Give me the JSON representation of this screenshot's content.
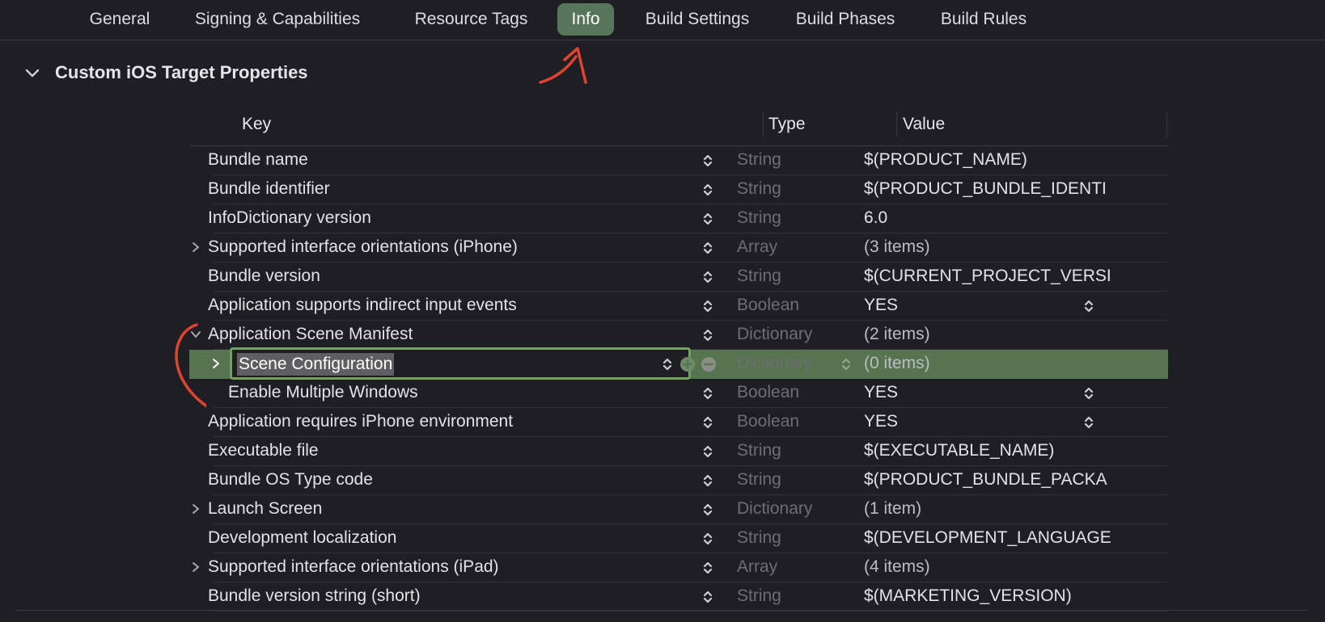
{
  "tabs": [
    {
      "label": "General"
    },
    {
      "label": "Signing & Capabilities"
    },
    {
      "label": "Resource Tags"
    },
    {
      "label": "Info",
      "selected": true
    },
    {
      "label": "Build Settings"
    },
    {
      "label": "Build Phases"
    },
    {
      "label": "Build Rules"
    }
  ],
  "section": {
    "title": "Custom iOS Target Properties"
  },
  "columns": {
    "key": "Key",
    "type": "Type",
    "value": "Value"
  },
  "rows": [
    {
      "key": "Bundle name",
      "type": "String",
      "value": "$(PRODUCT_NAME)"
    },
    {
      "key": "Bundle identifier",
      "type": "String",
      "value": "$(PRODUCT_BUNDLE_IDENTI"
    },
    {
      "key": "InfoDictionary version",
      "type": "String",
      "value": "6.0"
    },
    {
      "key": "Supported interface orientations (iPhone)",
      "type": "Array",
      "value": "(3 items)",
      "disclosure": "collapsed"
    },
    {
      "key": "Bundle version",
      "type": "String",
      "value": "$(CURRENT_PROJECT_VERSI"
    },
    {
      "key": "Application supports indirect input events",
      "type": "Boolean",
      "value": "YES",
      "value_popup": true
    },
    {
      "key": "Application Scene Manifest",
      "type": "Dictionary",
      "value": "(2 items)",
      "disclosure": "expanded"
    },
    {
      "key": "Scene Configuration",
      "type": "Dictionary",
      "value": "(0 items)",
      "disclosure": "collapsed",
      "indent": 1,
      "selected": true,
      "editing": true
    },
    {
      "key": "Enable Multiple Windows",
      "type": "Boolean",
      "value": "YES",
      "value_popup": true,
      "indent": 1
    },
    {
      "key": "Application requires iPhone environment",
      "type": "Boolean",
      "value": "YES",
      "value_popup": true
    },
    {
      "key": "Executable file",
      "type": "String",
      "value": "$(EXECUTABLE_NAME)"
    },
    {
      "key": "Bundle OS Type code",
      "type": "String",
      "value": "$(PRODUCT_BUNDLE_PACKA"
    },
    {
      "key": "Launch Screen",
      "type": "Dictionary",
      "value": "(1 item)",
      "disclosure": "collapsed"
    },
    {
      "key": "Development localization",
      "type": "String",
      "value": "$(DEVELOPMENT_LANGUAGE"
    },
    {
      "key": "Supported interface orientations (iPad)",
      "type": "Array",
      "value": "(4 items)",
      "disclosure": "collapsed"
    },
    {
      "key": "Bundle version string (short)",
      "type": "String",
      "value": "$(MARKETING_VERSION)"
    }
  ],
  "colors": {
    "background": "#1f1e24",
    "selected_tab": "#56755a",
    "selected_row": "#55744f",
    "edit_border": "#71a35f",
    "annotation": "#e0432f"
  },
  "icons": {
    "section_toggle": "chevron-down-icon",
    "row_stepper": "up-down-chevron-icon",
    "add": "plus-circle-icon",
    "remove": "minus-circle-icon"
  }
}
